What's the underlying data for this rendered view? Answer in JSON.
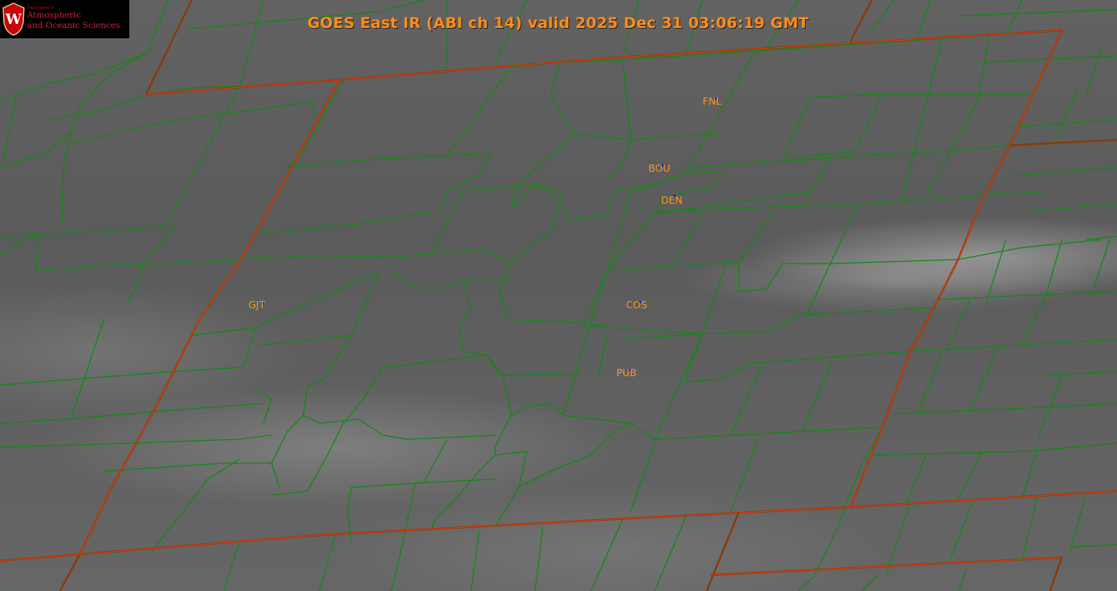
{
  "header": {
    "title": "GOES East IR (ABI ch 14) valid 2025 Dec 31 03:06:19 GMT"
  },
  "logo": {
    "department_line": "Department of",
    "name_line1": "Atmospheric",
    "name_line2": "and Oceanic Sciences",
    "shield_letter": "W"
  },
  "stations": [
    {
      "id": "fnl",
      "label": "FNL"
    },
    {
      "id": "bou",
      "label": "BOU"
    },
    {
      "id": "den",
      "label": "DEN"
    },
    {
      "id": "cos",
      "label": "COS"
    },
    {
      "id": "pub",
      "label": "PUB"
    },
    {
      "id": "gjt",
      "label": "GJT"
    }
  ],
  "colors": {
    "title": "#ff8c1a",
    "county_lines": "#118a11",
    "state_lines": "#8a3a08",
    "station_labels": "#ff9420",
    "station_markers": "#1010ff",
    "logo_text": "#d21f3c"
  }
}
